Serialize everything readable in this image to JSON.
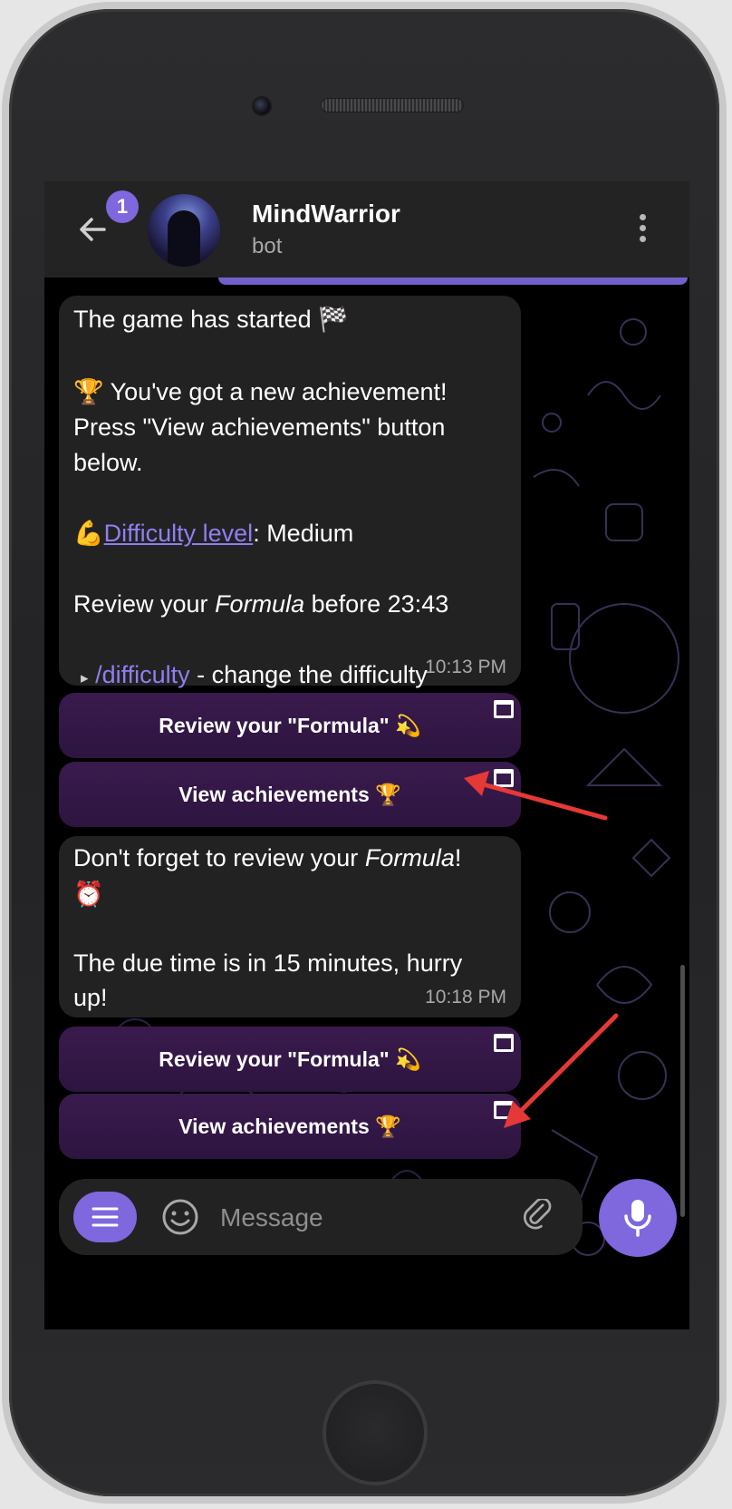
{
  "chat": {
    "title": "MindWarrior",
    "subtitle": "bot",
    "unread_badge": "1"
  },
  "message1": {
    "line1": "The game has started 🏁",
    "line2": "🏆 You've got a new achievement!",
    "line3": "Press \"View achievements\" button",
    "line4": "below.",
    "difficulty_icon": "💪",
    "difficulty_link": "Difficulty level",
    "difficulty_value": ": Medium",
    "review_prefix": "Review your ",
    "review_formula": "Formula",
    "review_suffix": " before 23:43",
    "bullet": "▸",
    "command": "/difficulty",
    "command_desc": " - change the difficulty",
    "time": "10:13 PM"
  },
  "keyboard1": {
    "review_label": "Review your \"Formula\" 💫",
    "achievements_label": "View achievements 🏆"
  },
  "message2": {
    "line1_prefix": "Don't forget to review your ",
    "line1_formula": "Formula",
    "line1_suffix": "!",
    "line2": "⏰",
    "line3": "The due time is in 15 minutes, hurry",
    "line4": "up!",
    "time": "10:18 PM"
  },
  "keyboard2": {
    "review_label": "Review your \"Formula\" 💫",
    "achievements_label": "View achievements 🏆"
  },
  "composer": {
    "placeholder": "Message"
  },
  "colors": {
    "accent": "#7f67dd",
    "bubble": "#222222",
    "keyboard_button": "#3a1a4d",
    "annotation_arrow": "#e53935"
  },
  "icons": {
    "back": "back-arrow-icon",
    "menu": "more-vertical-icon",
    "bot_menu": "menu-lines-icon",
    "emoji": "emoji-smile-icon",
    "attach": "paperclip-icon",
    "mic": "microphone-icon",
    "link_out": "external-link-icon"
  }
}
